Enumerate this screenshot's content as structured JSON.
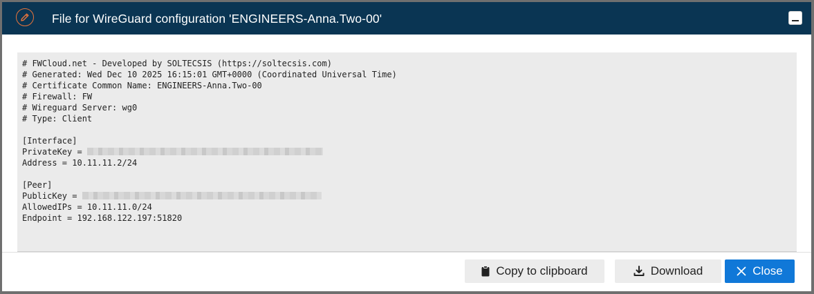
{
  "dialog": {
    "title": "File for WireGuard configuration 'ENGINEERS-Anna.Two-00'",
    "header_icon": "pencil-icon",
    "minimize_icon": "minimize-icon"
  },
  "config": {
    "lines": {
      "l1": "# FWCloud.net - Developed by SOLTECSIS (https://soltecsis.com)",
      "l2": "# Generated: Wed Dec 10 2025 16:15:01 GMT+0000 (Coordinated Universal Time)",
      "l3": "# Certificate Common Name: ENGINEERS-Anna.Two-00",
      "l4": "# Firewall: FW",
      "l5": "# Wireguard Server: wg0",
      "l6": "# Type: Client",
      "l7": "[Interface]",
      "l8": "PrivateKey = ",
      "l9": "Address = 10.11.11.2/24",
      "l10": "[Peer]",
      "l11": "PublicKey = ",
      "l12": "AllowedIPs = 10.11.11.0/24",
      "l13": "Endpoint = 192.168.122.197:51820"
    }
  },
  "footer": {
    "copy_label": "Copy to clipboard",
    "download_label": "Download",
    "close_label": "Close",
    "copy_icon": "clipboard-icon",
    "download_icon": "download-icon",
    "close_icon": "close-icon"
  },
  "colors": {
    "header_bg": "#0a3553",
    "accent": "#e8743b",
    "primary_button": "#1078d8"
  }
}
